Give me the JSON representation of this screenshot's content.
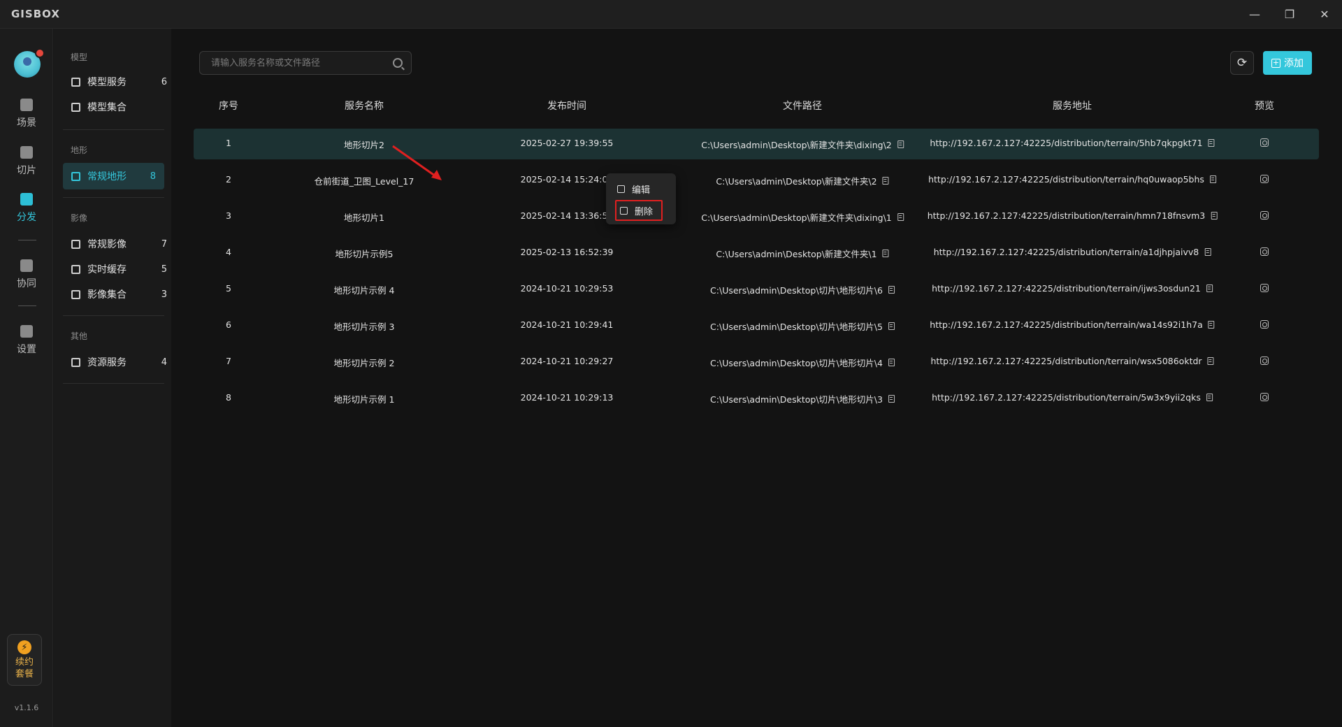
{
  "app": {
    "logo": "GISBOX",
    "version": "v1.1.6"
  },
  "window": {
    "minimize": "—",
    "restore": "❐",
    "close": "✕"
  },
  "rail": {
    "items": [
      {
        "label": "场景"
      },
      {
        "label": "切片"
      },
      {
        "label": "分发"
      },
      {
        "label": "协同"
      },
      {
        "label": "设置"
      }
    ],
    "upgrade": {
      "line1": "续约",
      "line2": "套餐",
      "icon": "⚡"
    }
  },
  "sidebar": {
    "groups": [
      {
        "title": "模型",
        "items": [
          {
            "label": "模型服务",
            "count": "6"
          },
          {
            "label": "模型集合",
            "count": ""
          }
        ]
      },
      {
        "title": "地形",
        "items": [
          {
            "label": "常规地形",
            "count": "8"
          }
        ]
      },
      {
        "title": "影像",
        "items": [
          {
            "label": "常规影像",
            "count": "7"
          },
          {
            "label": "实时缓存",
            "count": "5"
          },
          {
            "label": "影像集合",
            "count": "3"
          }
        ]
      },
      {
        "title": "其他",
        "items": [
          {
            "label": "资源服务",
            "count": "4"
          }
        ]
      }
    ]
  },
  "toolbar": {
    "search_placeholder": "请输入服务名称或文件路径",
    "refresh_icon": "⟳",
    "add_label": "添加"
  },
  "table": {
    "headers": [
      "序号",
      "服务名称",
      "发布时间",
      "文件路径",
      "服务地址",
      "预览"
    ],
    "rows": [
      {
        "no": "1",
        "name": "地形切片2",
        "time": "2025-02-27 19:39:55",
        "path": "C:\\Users\\admin\\Desktop\\新建文件夹\\dixing\\2",
        "url": "http://192.167.2.127:42225/distribution/terrain/5hb7qkpgkt71"
      },
      {
        "no": "2",
        "name": "仓前街道_卫图_Level_17",
        "time": "2025-02-14 15:24:07",
        "path": "C:\\Users\\admin\\Desktop\\新建文件夹\\2",
        "url": "http://192.167.2.127:42225/distribution/terrain/hq0uwaop5bhs"
      },
      {
        "no": "3",
        "name": "地形切片1",
        "time": "2025-02-14 13:36:52",
        "path": "C:\\Users\\admin\\Desktop\\新建文件夹\\dixing\\1",
        "url": "http://192.167.2.127:42225/distribution/terrain/hmn718fnsvm3"
      },
      {
        "no": "4",
        "name": "地形切片示例5",
        "time": "2025-02-13 16:52:39",
        "path": "C:\\Users\\admin\\Desktop\\新建文件夹\\1",
        "url": "http://192.167.2.127:42225/distribution/terrain/a1djhpjaivv8"
      },
      {
        "no": "5",
        "name": "地形切片示例 4",
        "time": "2024-10-21 10:29:53",
        "path": "C:\\Users\\admin\\Desktop\\切片\\地形切片\\6",
        "url": "http://192.167.2.127:42225/distribution/terrain/ijws3osdun21"
      },
      {
        "no": "6",
        "name": "地形切片示例 3",
        "time": "2024-10-21 10:29:41",
        "path": "C:\\Users\\admin\\Desktop\\切片\\地形切片\\5",
        "url": "http://192.167.2.127:42225/distribution/terrain/wa14s92i1h7a"
      },
      {
        "no": "7",
        "name": "地形切片示例 2",
        "time": "2024-10-21 10:29:27",
        "path": "C:\\Users\\admin\\Desktop\\切片\\地形切片\\4",
        "url": "http://192.167.2.127:42225/distribution/terrain/wsx5086oktdr"
      },
      {
        "no": "8",
        "name": "地形切片示例 1",
        "time": "2024-10-21 10:29:13",
        "path": "C:\\Users\\admin\\Desktop\\切片\\地形切片\\3",
        "url": "http://192.167.2.127:42225/distribution/terrain/5w3x9yii2qks"
      }
    ]
  },
  "context_menu": {
    "edit": "编辑",
    "delete": "删除"
  },
  "colors": {
    "accent": "#34c7dc",
    "selected_row": "#1c3233",
    "annotation": "#e02020"
  }
}
